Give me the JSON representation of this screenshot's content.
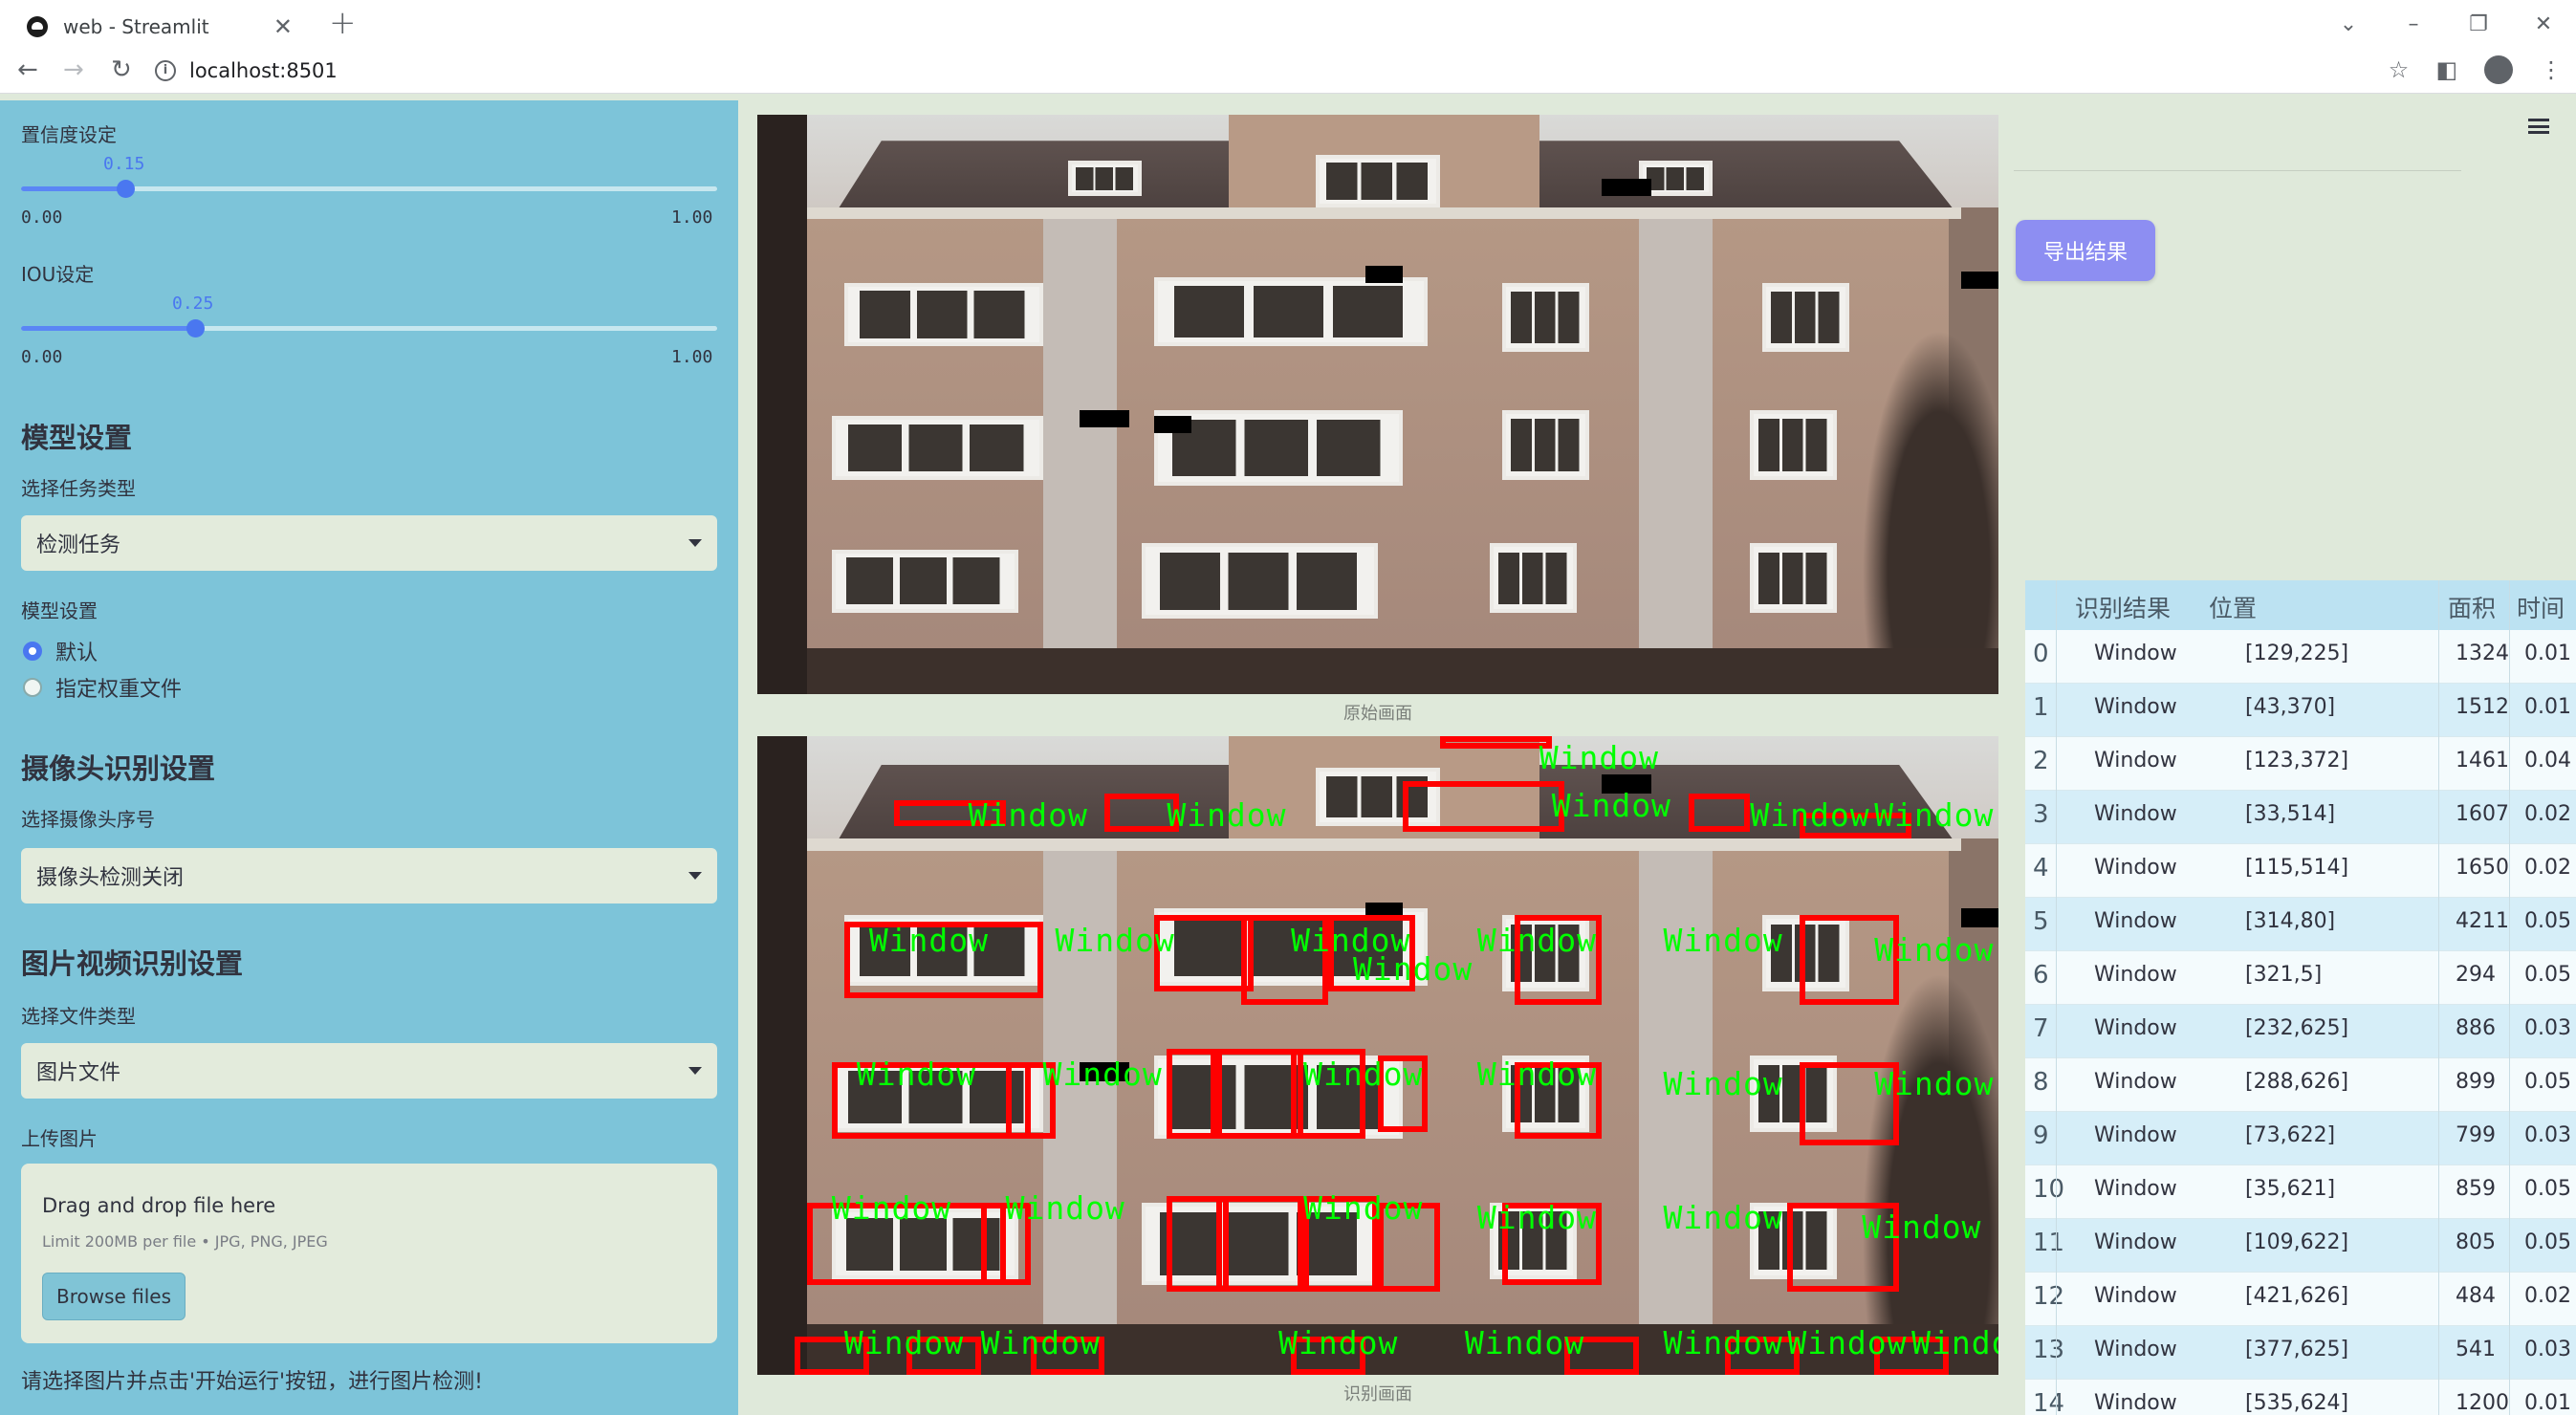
{
  "browser": {
    "tab_title": "web - Streamlit",
    "url": "localhost:8501"
  },
  "sidebar": {
    "confidence": {
      "label": "置信度设定",
      "value_text": "0.15",
      "value": 0.15,
      "min": "0.00",
      "max": "1.00"
    },
    "iou": {
      "label": "IOU设定",
      "value_text": "0.25",
      "value": 0.25,
      "min": "0.00",
      "max": "1.00"
    },
    "model_settings_heading": "模型设置",
    "task_type_label": "选择任务类型",
    "task_type_value": "检测任务",
    "model_label": "模型设置",
    "model_options": [
      "默认",
      "指定权重文件"
    ],
    "camera_heading": "摄像头识别设置",
    "camera_label": "选择摄像头序号",
    "camera_value": "摄像头检测关闭",
    "media_heading": "图片视频识别设置",
    "file_type_label": "选择文件类型",
    "file_type_value": "图片文件",
    "upload_label": "上传图片",
    "upload_title": "Drag and drop file here",
    "upload_sub": "Limit 200MB per file • JPG, PNG, JPEG",
    "browse_label": "Browse files",
    "footer_hint": "请选择图片并点击'开始运行'按钮，进行图片检测!"
  },
  "main": {
    "original_caption": "原始画面",
    "result_caption": "识别画面",
    "detection_label": "Window"
  },
  "right": {
    "export_label": "导出结果",
    "table": {
      "headers": [
        "识别结果",
        "位置",
        "面积",
        "时间"
      ],
      "rows": [
        [
          "0",
          "Window",
          "[129,225]",
          "1324",
          "0.01"
        ],
        [
          "1",
          "Window",
          "[43,370]",
          "1512",
          "0.01"
        ],
        [
          "2",
          "Window",
          "[123,372]",
          "1461",
          "0.04"
        ],
        [
          "3",
          "Window",
          "[33,514]",
          "1607",
          "0.02"
        ],
        [
          "4",
          "Window",
          "[115,514]",
          "1650",
          "0.02"
        ],
        [
          "5",
          "Window",
          "[314,80]",
          "4211",
          "0.05"
        ],
        [
          "6",
          "Window",
          "[321,5]",
          "294",
          "0.05"
        ],
        [
          "7",
          "Window",
          "[232,625]",
          "886",
          "0.03"
        ],
        [
          "8",
          "Window",
          "[288,626]",
          "899",
          "0.05"
        ],
        [
          "9",
          "Window",
          "[73,622]",
          "799",
          "0.03"
        ],
        [
          "10",
          "Window",
          "[35,621]",
          "859",
          "0.05"
        ],
        [
          "11",
          "Window",
          "[109,622]",
          "805",
          "0.05"
        ],
        [
          "12",
          "Window",
          "[421,626]",
          "484",
          "0.02"
        ],
        [
          "13",
          "Window",
          "[377,625]",
          "541",
          "0.03"
        ],
        [
          "14",
          "Window",
          "[535,624]",
          "1200",
          "0.01"
        ]
      ]
    }
  },
  "colors": {
    "sidebar_bg": "#7dc4d9",
    "accent": "#4a77f0",
    "export_button": "#8d8ef2",
    "detection_box": "#ff0000",
    "detection_text": "#00ff00"
  }
}
